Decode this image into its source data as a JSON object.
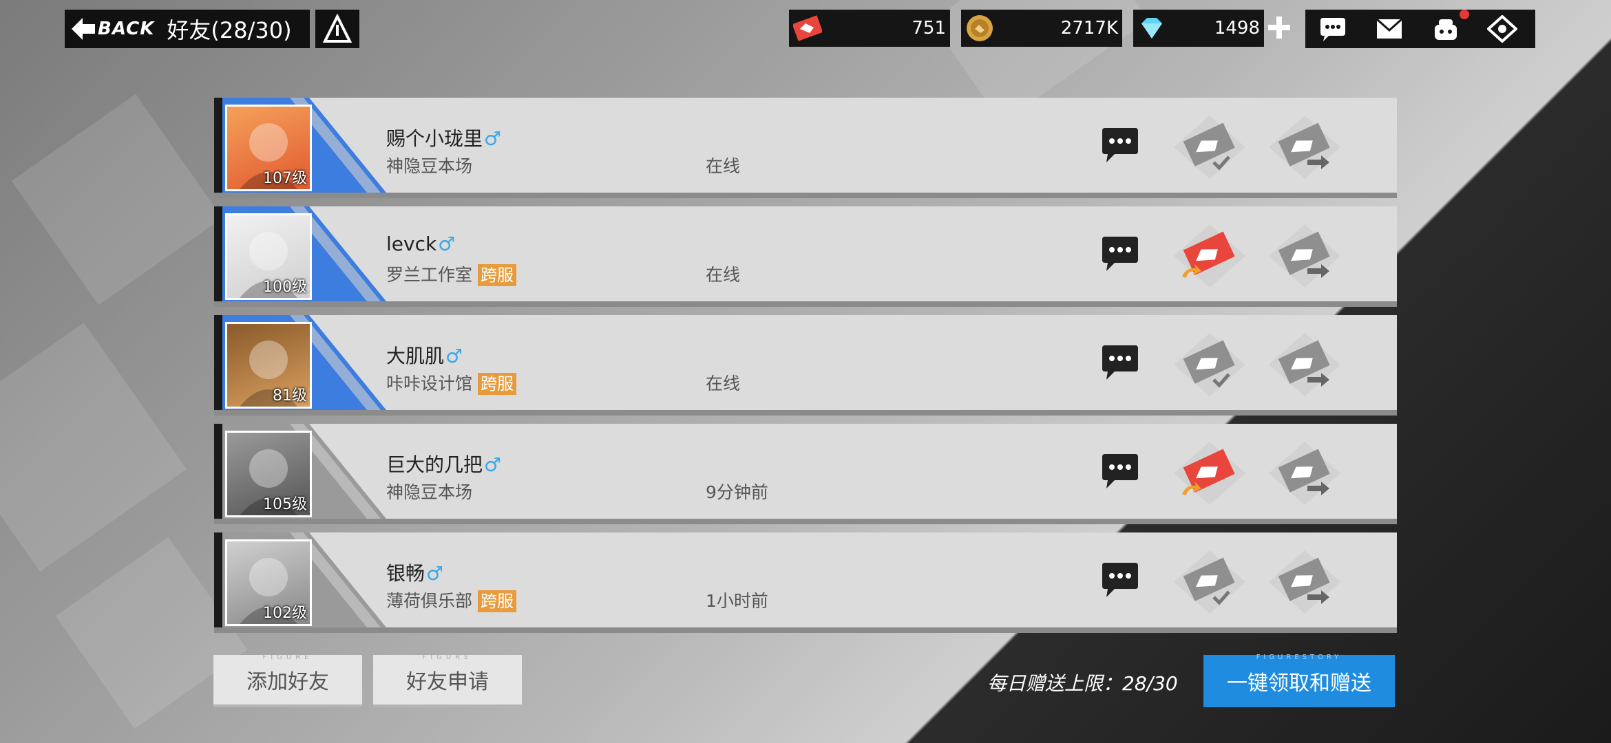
{
  "header": {
    "back_label": "BACK",
    "title": "好友(28/30)"
  },
  "resources": {
    "friendship": "751",
    "gold": "2717K",
    "diamond": "1498"
  },
  "friends": [
    {
      "name": "赐个小珑里",
      "gender": "♂",
      "club": "神隐豆本场",
      "cross_server": "",
      "status": "在线",
      "level": "107级",
      "active": true,
      "gift_ready": false
    },
    {
      "name": "levck",
      "gender": "♂",
      "club": "罗兰工作室",
      "cross_server": "跨服",
      "status": "在线",
      "level": "100级",
      "active": true,
      "gift_ready": true
    },
    {
      "name": "大肌肌",
      "gender": "♂",
      "club": "咔咔设计馆",
      "cross_server": "跨服",
      "status": "在线",
      "level": "81级",
      "active": true,
      "gift_ready": false
    },
    {
      "name": "巨大的几把",
      "gender": "♂",
      "club": "神隐豆本场",
      "cross_server": "",
      "status": "9分钟前",
      "level": "105级",
      "active": false,
      "gift_ready": true
    },
    {
      "name": "银畅",
      "gender": "♂",
      "club": "薄荷俱乐部",
      "cross_server": "跨服",
      "status": "1小时前",
      "level": "102级",
      "active": false,
      "gift_ready": false
    }
  ],
  "footer": {
    "add_friend": "添加好友",
    "friend_requests": "好友申请",
    "daily_limit": "每日赠送上限：28/30",
    "claim_all": "一键领取和赠送",
    "sub_figure": "FIGURE",
    "sub_figurestory": "FIGURESTORY"
  },
  "colors": {
    "accent_blue": "#1f8ce0",
    "stripe_blue": "#3d7de0",
    "cross_server": "#e89b3c",
    "gift_red": "#e8453c",
    "male": "#3aa8e8"
  },
  "icons": {
    "back": "back-arrow-icon",
    "info": "info-triangle-icon",
    "friendship": "handshake-icon",
    "gold": "gold-coin-icon",
    "diamond": "diamond-icon",
    "plus": "plus-icon",
    "chat": "chat-bubble-icon",
    "mail": "mail-icon",
    "gift": "gift-icon",
    "settings": "settings-icon"
  }
}
